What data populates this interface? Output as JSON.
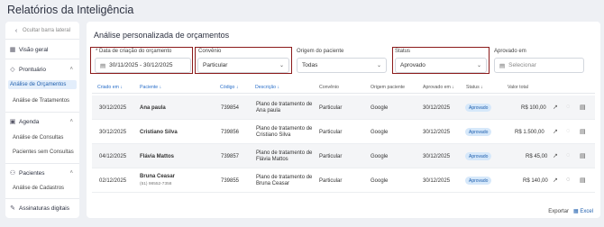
{
  "page_title": "Relatórios da Inteligência",
  "sidebar": {
    "collapse_label": "Ocultar barra lateral",
    "overview": "Visão geral",
    "sections": [
      {
        "label": "Prontuário",
        "items": [
          "Análise de Orçamentos",
          "Análise de Tratamentos"
        ]
      },
      {
        "label": "Agenda",
        "items": [
          "Análise de Consultas",
          "Pacientes sem Consultas"
        ]
      },
      {
        "label": "Pacientes",
        "items": [
          "Análise de Cadastros"
        ]
      }
    ],
    "subscriptions": "Assinaturas digitais"
  },
  "main": {
    "title": "Análise personalizada de orçamentos",
    "filters": {
      "date": {
        "label": "* Data de criação do orçamento",
        "value": "30/11/2025 - 30/12/2025"
      },
      "convenio": {
        "label": "Convênio",
        "value": "Particular"
      },
      "origem": {
        "label": "Origem do paciente",
        "value": "Todas"
      },
      "status": {
        "label": "Status",
        "value": "Aprovado"
      },
      "aprovado": {
        "label": "Aprovado em",
        "placeholder": "Selecionar"
      }
    },
    "columns": [
      "Criado em",
      "Paciente",
      "Código",
      "Descrição",
      "Convênio",
      "Origem paciente",
      "Aprovado em",
      "Status",
      "Valor total"
    ],
    "rows": [
      {
        "criado": "30/12/2025",
        "paciente": "Ana paula",
        "telefone": "",
        "codigo": "739854",
        "descricao": "Plano de tratamento de Ana paula",
        "convenio": "Particular",
        "origem": "Google",
        "aprovado": "30/12/2025",
        "status": "Aprovado",
        "valor": "R$ 100,00"
      },
      {
        "criado": "30/12/2025",
        "paciente": "Cristiano Silva",
        "telefone": "",
        "codigo": "739856",
        "descricao": "Plano de tratamento de Cristiano Silva",
        "convenio": "Particular",
        "origem": "Google",
        "aprovado": "30/12/2025",
        "status": "Aprovado",
        "valor": "R$ 1.500,00"
      },
      {
        "criado": "04/12/2025",
        "paciente": "Flávia Mattos",
        "telefone": "",
        "codigo": "739857",
        "descricao": "Plano de tratamento de Flávia Mattos",
        "convenio": "Particular",
        "origem": "Google",
        "aprovado": "30/12/2025",
        "status": "Aprovado",
        "valor": "R$ 45,00"
      },
      {
        "criado": "02/12/2025",
        "paciente": "Bruna Ceasar",
        "telefone": "(51) 98552-7358",
        "codigo": "739855",
        "descricao": "Plano de tratamento de Bruna Ceasar",
        "convenio": "Particular",
        "origem": "Google",
        "aprovado": "30/12/2025",
        "status": "Aprovado",
        "valor": "R$ 140,00"
      }
    ]
  },
  "footer": {
    "export_label": "Exportar",
    "excel_label": "Excel"
  }
}
